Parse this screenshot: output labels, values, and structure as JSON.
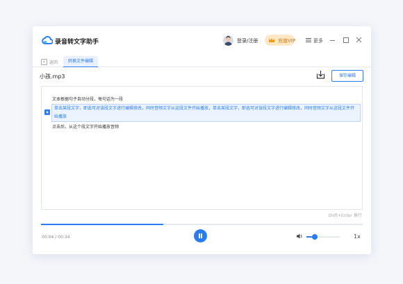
{
  "app": {
    "title": "录音转文字助手",
    "login_label": "登录/注册",
    "vip_label": "充值VIP",
    "more_label": "更多"
  },
  "tabs": {
    "back_label": "返回",
    "active_tab_label": "转换文件编辑"
  },
  "file": {
    "name": "小孩.mp3",
    "save_label": "保存编辑"
  },
  "editor": {
    "paragraphs": [
      "文本根据句子自动分段，每句话为一段",
      "单击某段文字，即选可对该段文字进行编辑修改，同时音频文字从这段文件开始播放，单击某段文字，即选可对该段文字进行编辑修改，同时音频文字从这段文件开始播放",
      "点击后，从这个段文字开始播放音频"
    ],
    "shortcut_hint": "Shift+Enter 换行"
  },
  "player": {
    "current_time": "00:04",
    "total_time": "00:34",
    "time_separator": " / ",
    "progress": 0.38,
    "volume": 0.25,
    "speed_label": "1x"
  },
  "icons": {
    "logo": "cloud-logo-icon",
    "download": "download-icon",
    "volume": "volume-icon",
    "play": "play-icon",
    "pause": "pause-icon"
  },
  "colors": {
    "accent": "#2a7cf2",
    "vip_bg": "#fde7c4",
    "vip_text": "#c77a1b",
    "highlight_bg": "#eaf3ff"
  }
}
